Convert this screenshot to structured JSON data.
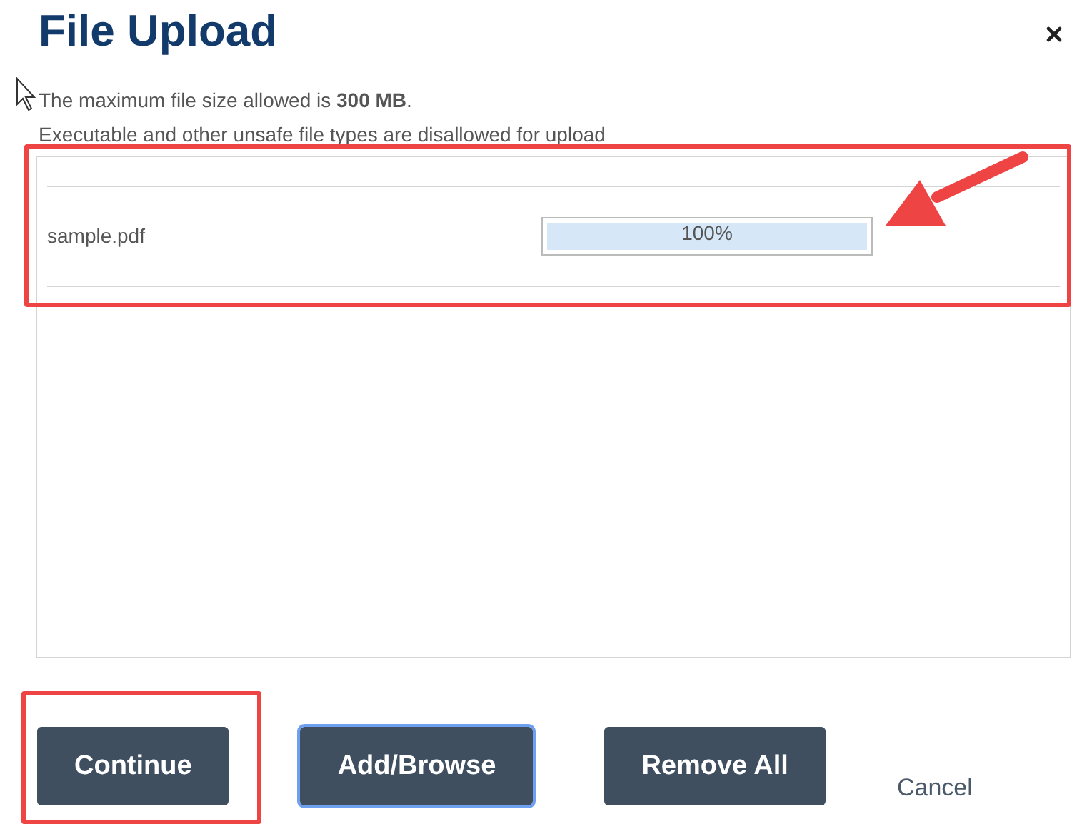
{
  "dialog": {
    "title": "File Upload"
  },
  "notices": [
    "The maximum file size allowed is **300 MB**.",
    "Executable and other unsafe file types are disallowed for upload"
  ],
  "files": [
    {
      "name": "sample.pdf",
      "level": 1,
      "reading": "100%"
    }
  ],
  "buttons": [
    {
      "label": "Continue",
      "kind": "primary",
      "focused": false
    },
    {
      "label": "Add/Browse",
      "kind": "primary",
      "focused": true
    },
    {
      "label": "Remove All",
      "kind": "primary",
      "focused": false
    },
    {
      "label": "Cancel",
      "kind": "link"
    }
  ]
}
